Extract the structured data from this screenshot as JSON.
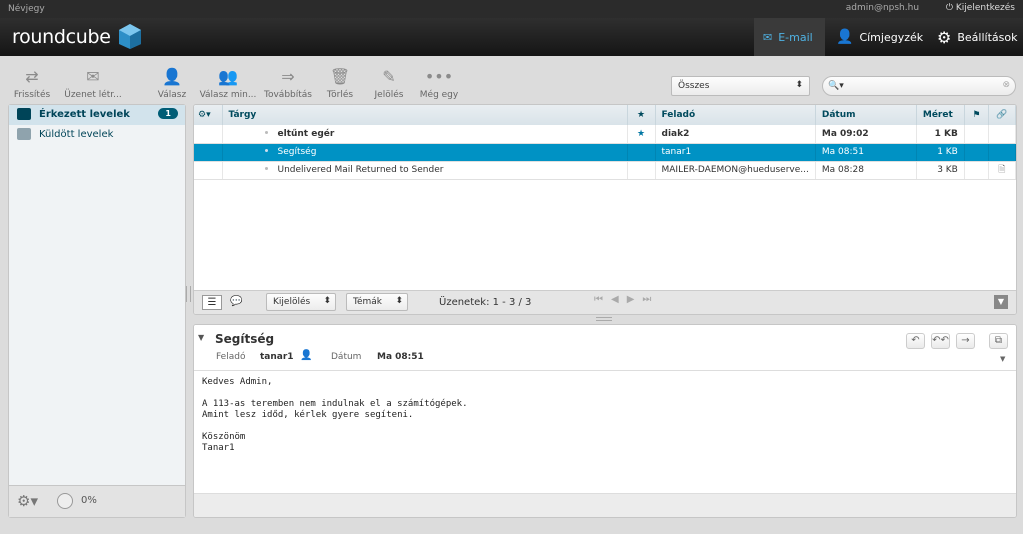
{
  "topbar": {
    "left": "Névjegy",
    "user": "admin@npsh.hu",
    "logout": "Kijelentkezés"
  },
  "header": {
    "logo": "roundcube",
    "tabs": [
      "E-mail",
      "Címjegyzék",
      "Beállítások"
    ]
  },
  "toolbar": {
    "buttons": [
      "Frissítés",
      "Üzenet létr...",
      "Válasz",
      "Válasz min...",
      "Továbbítás",
      "Törlés",
      "Jelölés",
      "Még egy"
    ],
    "filter": "Összes",
    "search_placeholder": ""
  },
  "folders": [
    {
      "name": "Érkezett levelek",
      "count": "1"
    },
    {
      "name": "Küldött levelek"
    }
  ],
  "folders_footer": {
    "quota": "0%"
  },
  "list": {
    "columns": [
      "Tárgy",
      "Feladó",
      "Dátum",
      "Méret"
    ],
    "rows": [
      {
        "subject": "eltűnt egér",
        "from": "diak2",
        "date": "Ma 09:02",
        "size": "1 KB"
      },
      {
        "subject": "Segítség",
        "from": "tanar1",
        "date": "Ma 08:51",
        "size": "1 KB"
      },
      {
        "subject": "Undelivered Mail Returned to Sender",
        "from": "MAILER-DAEMON@hueduserve...",
        "date": "Ma 08:28",
        "size": "3 KB"
      }
    ],
    "footer": {
      "select": "Kijelölés",
      "threads": "Témák",
      "count": "Üzenetek: 1 - 3 / 3"
    }
  },
  "preview": {
    "subject": "Segítség",
    "from_label": "Feladó",
    "from": "tanar1",
    "date_label": "Dátum",
    "date": "Ma 08:51",
    "body": "Kedves Admin,\n\nA 113-as teremben nem indulnak el a számítógépek.\nAmint lesz időd, kérlek gyere segíteni.\n\nKöszönöm\nTanar1"
  }
}
